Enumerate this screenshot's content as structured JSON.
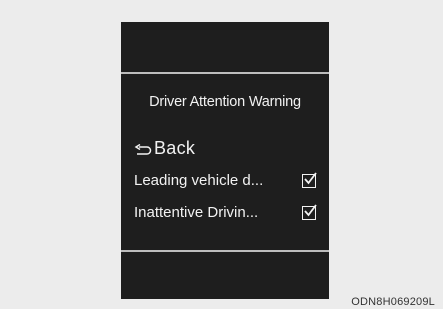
{
  "screen": {
    "title": "Driver Attention Warning",
    "back_label": "Back",
    "back_icon": "return-arrow-icon",
    "options": [
      {
        "label": "Leading vehicle d...",
        "checked": true
      },
      {
        "label": "Inattentive Drivin...",
        "checked": true
      }
    ]
  },
  "caption": "ODN8H069209L",
  "colors": {
    "background": "#ececec",
    "screen": "#1e1e1e",
    "text": "#f2f2f2",
    "divider": "#bdbdbd"
  }
}
